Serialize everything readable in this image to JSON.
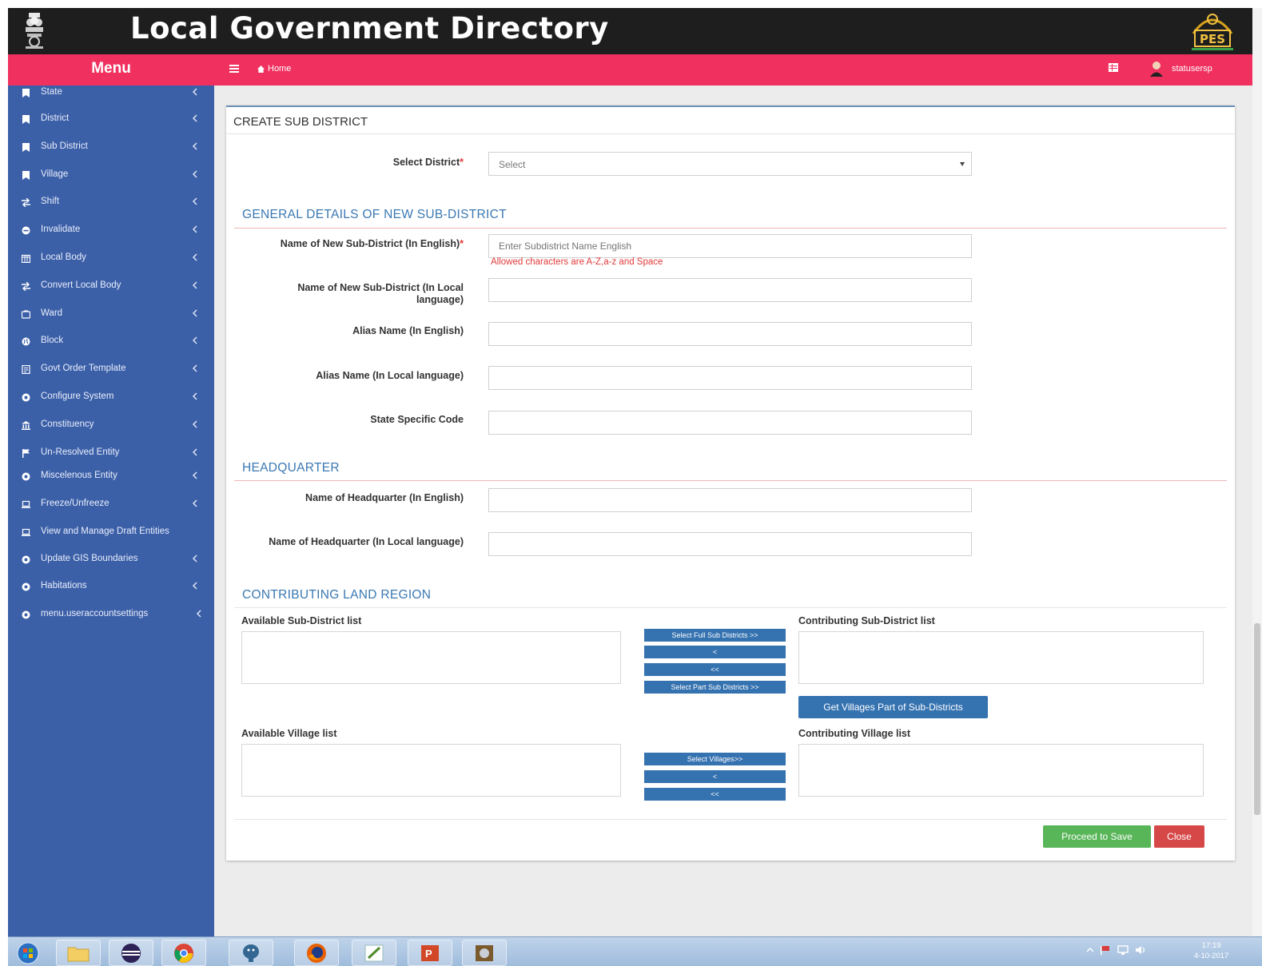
{
  "header": {
    "title": "Local Government Directory",
    "logo_text": "PES"
  },
  "navbar": {
    "menu_title": "Menu",
    "home": "Home",
    "user": "statusersp"
  },
  "sidebar": {
    "items": [
      {
        "label": "State",
        "icon": "bookmark-icon"
      },
      {
        "label": "District",
        "icon": "bookmark-icon"
      },
      {
        "label": "Sub District",
        "icon": "bookmark-icon"
      },
      {
        "label": "Village",
        "icon": "bookmark-icon"
      },
      {
        "label": "Shift",
        "icon": "shift-icon"
      },
      {
        "label": "Invalidate",
        "icon": "circle-icon"
      },
      {
        "label": "Local Body",
        "icon": "building-icon"
      },
      {
        "label": "Convert Local Body",
        "icon": "shift-icon"
      },
      {
        "label": "Ward",
        "icon": "ward-icon"
      },
      {
        "label": "Block",
        "icon": "globe-icon"
      },
      {
        "label": "Govt Order Template",
        "icon": "document-icon"
      },
      {
        "label": "Configure System",
        "icon": "circle-icon"
      },
      {
        "label": "Constituency",
        "icon": "bank-icon"
      },
      {
        "label": "Un-Resolved Entity",
        "icon": "flag-icon"
      },
      {
        "label": "Miscelenous Entity",
        "icon": "circle-icon"
      },
      {
        "label": "Freeze/Unfreeze",
        "icon": "laptop-icon"
      },
      {
        "label": "View and Manage Draft Entities",
        "icon": "laptop-icon"
      },
      {
        "label": "Update GIS Boundaries",
        "icon": "circle-icon"
      },
      {
        "label": "Habitations",
        "icon": "circle-icon"
      },
      {
        "label": "menu.useraccountsettings",
        "icon": "circle-icon"
      }
    ]
  },
  "form": {
    "title": "CREATE SUB DISTRICT",
    "select_district_label": "Select District",
    "select_district_value": "Select",
    "section_general": "GENERAL DETAILS OF NEW SUB-DISTRICT",
    "name_english_label": "Name of New Sub-District (In English)",
    "name_english_placeholder": "Enter Subdistrict Name English",
    "name_english_hint": "Allowed characters are A-Z,a-z and Space",
    "name_local_label_1": "Name of New Sub-District (In Local",
    "name_local_label_2": "language)",
    "alias_english_label": "Alias Name (In English)",
    "alias_local_label": "Alias Name (In Local language)",
    "state_code_label": "State Specific Code",
    "section_hq": "HEADQUARTER",
    "hq_english_label": "Name of Headquarter (In English)",
    "hq_local_label": "Name of Headquarter (In Local language)",
    "section_land": "CONTRIBUTING LAND REGION",
    "available_subdistrict_label": "Available Sub-District list",
    "contributing_subdistrict_label": "Contributing Sub-District list",
    "available_village_label": "Available Village list",
    "contributing_village_label": "Contributing Village list",
    "btn_select_full": "Select Full Sub Districts >>",
    "btn_remove_one": "<",
    "btn_remove_all": "<<",
    "btn_select_part": "Select Part Sub Districts >>",
    "btn_get_villages": "Get Villages Part of Sub-Districts",
    "btn_select_villages": "Select Villages>>",
    "btn_remove_village": "<",
    "btn_remove_all_villages": "<<",
    "btn_save": "Proceed to Save",
    "btn_close": "Close",
    "required_mark": "*"
  },
  "taskbar": {
    "time": "17:19",
    "date": "4-10-2017"
  },
  "colors": {
    "header_bg": "#1e1e1e",
    "navbar_bg": "#f0315f",
    "sidebar_bg": "#3c60a8",
    "section_heading": "#3a78b2",
    "button_primary": "#3572b0",
    "button_success": "#58b558",
    "button_danger": "#d64848"
  }
}
